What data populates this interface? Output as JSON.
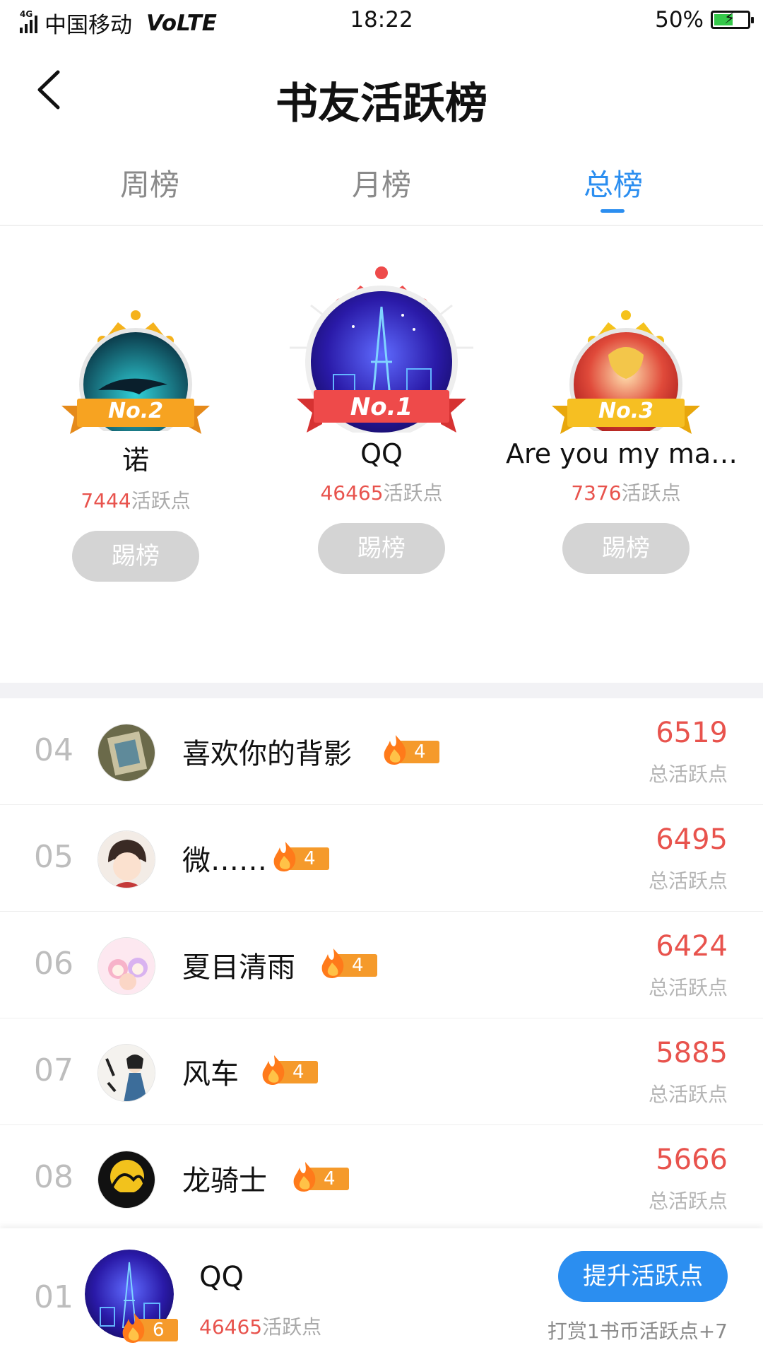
{
  "status_bar": {
    "network": "4G",
    "carrier": "中国移动",
    "volte": "VoLTE",
    "time": "18:22",
    "battery": "50%"
  },
  "header": {
    "title": "书友活跃榜"
  },
  "tabs": [
    {
      "label": "周榜",
      "active": false
    },
    {
      "label": "月榜",
      "active": false
    },
    {
      "label": "总榜",
      "active": true
    }
  ],
  "podium": {
    "second": {
      "rank_label": "No.2",
      "name": "诺",
      "points": "7444",
      "points_unit": "活跃点",
      "button": "踢榜"
    },
    "first": {
      "rank_label": "No.1",
      "name": "QQ",
      "points": "46465",
      "points_unit": "活跃点",
      "button": "踢榜"
    },
    "third": {
      "rank_label": "No.3",
      "name": "Are you my mas…",
      "points": "7376",
      "points_unit": "活跃点",
      "button": "踢榜"
    }
  },
  "list": [
    {
      "rank": "04",
      "name": "喜欢你的背影",
      "level": "4",
      "score": "6519",
      "score_label": "总活跃点"
    },
    {
      "rank": "05",
      "name": "微……",
      "level": "4",
      "score": "6495",
      "score_label": "总活跃点"
    },
    {
      "rank": "06",
      "name": "夏目清雨",
      "level": "4",
      "score": "6424",
      "score_label": "总活跃点"
    },
    {
      "rank": "07",
      "name": "风车",
      "level": "4",
      "score": "5885",
      "score_label": "总活跃点"
    },
    {
      "rank": "08",
      "name": "龙骑士",
      "level": "4",
      "score": "5666",
      "score_label": "总活跃点"
    }
  ],
  "me": {
    "rank": "01",
    "name": "QQ",
    "level": "6",
    "points": "46465",
    "points_unit": "活跃点",
    "button": "提升活跃点",
    "hint": "打赏1书币活跃点+7"
  },
  "colors": {
    "accent_blue": "#2b8ef0",
    "score_red": "#e8534d",
    "gold": "#f5b21c",
    "crown_red": "#ee4a4a",
    "level_orange": "#f59a2b"
  }
}
